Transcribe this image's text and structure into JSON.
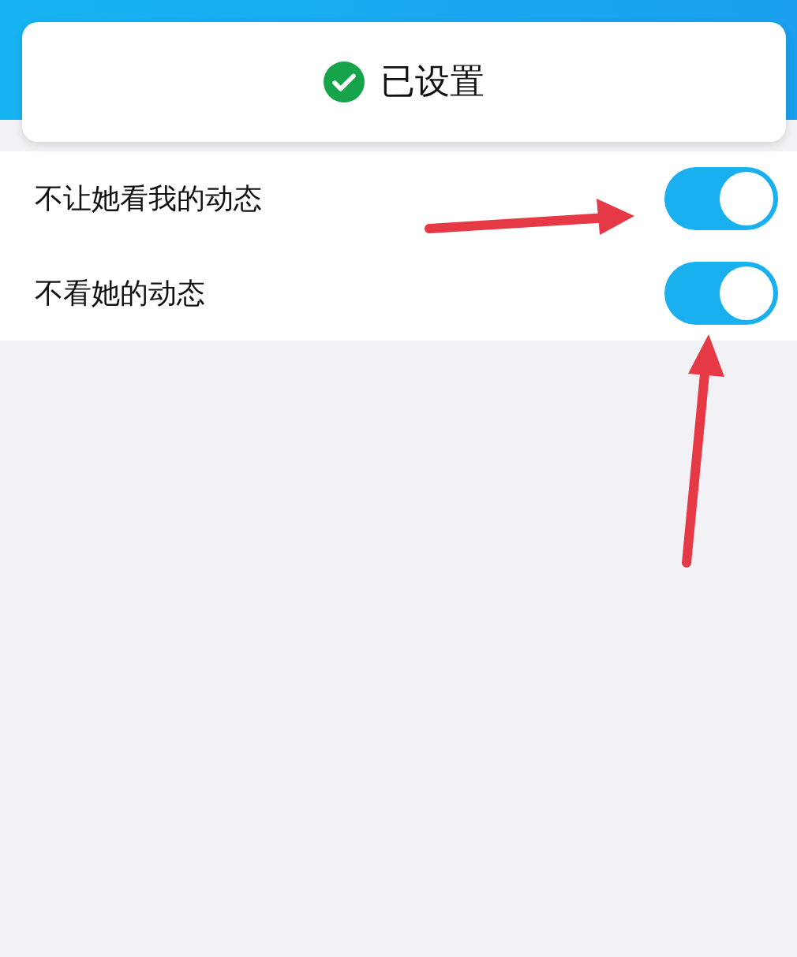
{
  "toast": {
    "text": "已设置"
  },
  "settings": [
    {
      "label": "不让她看我的动态",
      "on": true
    },
    {
      "label": "不看她的动态",
      "on": true
    }
  ]
}
